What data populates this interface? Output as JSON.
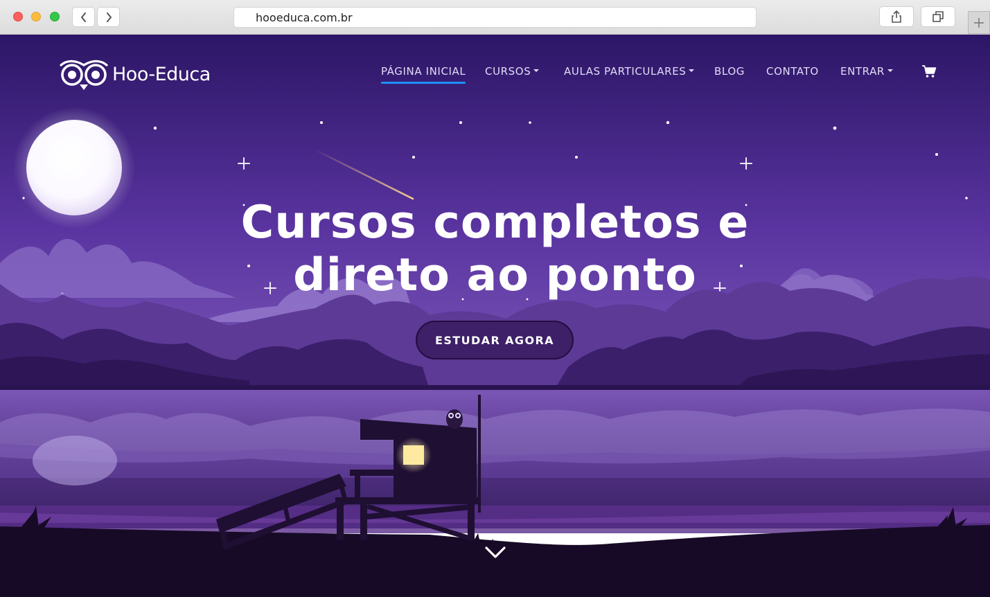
{
  "browser": {
    "url": "hooeduca.com.br"
  },
  "site": {
    "brand": "Hoo-Educa",
    "nav": [
      {
        "label": "PÁGINA INICIAL",
        "active": true,
        "dropdown": false
      },
      {
        "label": "CURSOS",
        "active": false,
        "dropdown": true
      },
      {
        "label": "AULAS PARTICULARES",
        "active": false,
        "dropdown": true
      },
      {
        "label": "BLOG",
        "active": false,
        "dropdown": false
      },
      {
        "label": "CONTATO",
        "active": false,
        "dropdown": false
      },
      {
        "label": "ENTRAR",
        "active": false,
        "dropdown": true
      }
    ],
    "cart_icon": "shopping-cart-icon"
  },
  "hero": {
    "line1": "Cursos completos e",
    "line2": "direto ao ponto",
    "cta_label": "ESTUDAR AGORA"
  },
  "colors": {
    "sky_top": "#2c1666",
    "sky_bottom": "#6a47ae",
    "active_underline": "#1e8fff",
    "window_light": "#fde9a0"
  }
}
